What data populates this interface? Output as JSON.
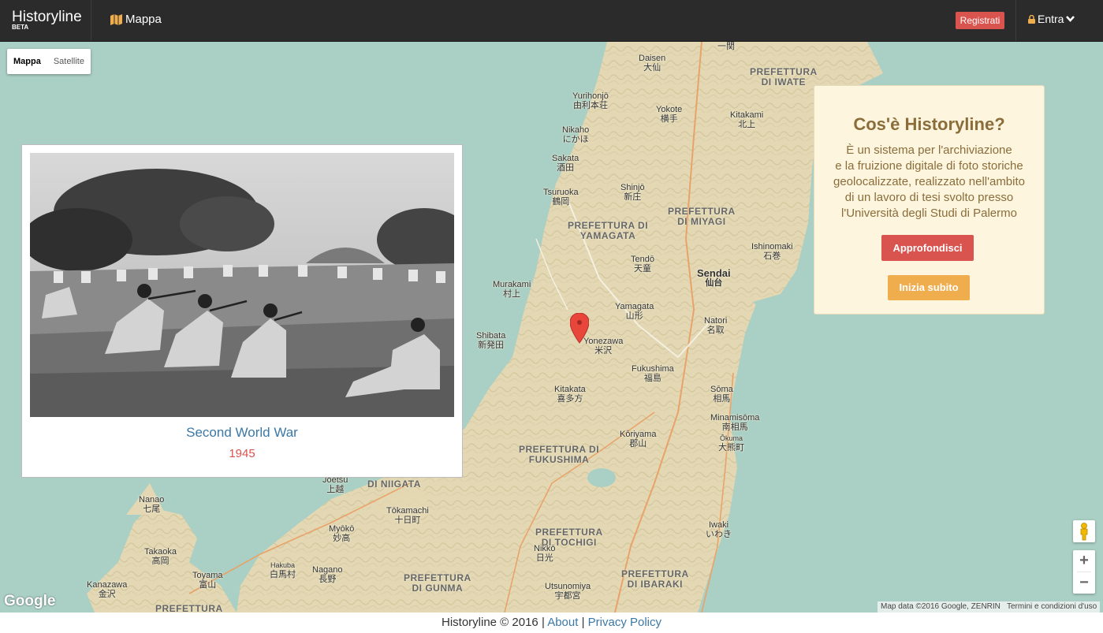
{
  "navbar": {
    "brand": "Historyline",
    "beta": "BETA",
    "map_link": "Mappa",
    "register": "Registrati",
    "login": "Entra",
    "icons": [
      "map-icon",
      "lock-icon",
      "chevron-down-icon"
    ]
  },
  "map_type": {
    "map": "Mappa",
    "satellite": "Satellite",
    "selected": "Mappa"
  },
  "photo_card": {
    "title": "Second World War",
    "year": "1945"
  },
  "info_panel": {
    "title": "Cos'è Historyline?",
    "text_lines": [
      "È un sistema per l'archiviazione",
      "e la fruizione digitale di foto storiche",
      "geolocalizzate, realizzato nell'ambito",
      "di un lavoro di tesi svolto presso",
      "l'Università degli Studi di Palermo"
    ],
    "btn_more": "Approfondisci",
    "btn_start": "Inizia subito"
  },
  "map_labels": {
    "daisen": "Daisen",
    "daisen_jp": "大仙",
    "yurihonjo": "Yurihonjō",
    "yurihonjo_jp": "由利本荘",
    "yokote": "Yokote",
    "yokote_jp": "横手",
    "kitakami": "Kitakami",
    "kitakami_jp": "北上",
    "nikaho": "Nikaho",
    "nikaho_jp": "にかほ",
    "sakata": "Sakata",
    "sakata_jp": "酒田",
    "tsuruoka": "Tsuruoka",
    "tsuruoka_jp": "鶴岡",
    "shinjo": "Shinjō",
    "shinjo_jp": "新庄",
    "ishinomaki": "Ishinomaki",
    "ishinomaki_jp": "石巻",
    "tendo": "Tendō",
    "tendo_jp": "天童",
    "sendai": "Sendai",
    "sendai_jp": "仙台",
    "murakami": "Murakami",
    "murakami_jp": "村上",
    "yamagata": "Yamagata",
    "yamagata_jp": "山形",
    "natori": "Natori",
    "natori_jp": "名取",
    "shibata": "Shibata",
    "shibata_jp": "新発田",
    "yonezawa": "Yonezawa",
    "yonezawa_jp": "米沢",
    "fukushima": "Fukushima",
    "fukushima_jp": "福島",
    "kitakata": "Kitakata",
    "kitakata_jp": "喜多方",
    "soma": "Sōma",
    "soma_jp": "相馬",
    "minamisoma": "Minamisōma",
    "minamisoma_jp": "南相馬",
    "okuma": "Ōkuma",
    "okuma_jp": "大熊町",
    "koriyama": "Kōriyama",
    "koriyama_jp": "郡山",
    "joetsu": "Joetsu",
    "joetsu_jp": "上越",
    "nanao": "Nanao",
    "nanao_jp": "七尾",
    "tokamachi": "Tōkamachi",
    "tokamachi_jp": "十日町",
    "myoko": "Myōkō",
    "myoko_jp": "妙高",
    "iwaki": "Iwaki",
    "iwaki_jp": "いわき",
    "takaoka": "Takaoka",
    "takaoka_jp": "高岡",
    "hakuba": "Hakuba",
    "hakuba_jp": "白馬村",
    "nagano": "Nagano",
    "nagano_jp": "長野",
    "nikko": "Nikkō",
    "nikko_jp": "日光",
    "toyama": "Toyama",
    "toyama_jp": "富山",
    "utsunomiya": "Utsunomiya",
    "utsunomiya_jp": "宇都宮",
    "kanazawa": "Kanazawa",
    "kanazawa_jp": "金沢",
    "ichinoseki_jp": "一関"
  },
  "prefectures": {
    "iwate": "PREFETTURA\nDI IWATE",
    "miyagi": "PREFETTURA\nDI MIYAGI",
    "yamagata": "PREFETTURA DI\nYAMAGATA",
    "fukushima": "PREFETTURA DI\nFUKUSHIMA",
    "niigata": "DI NIIGATA",
    "tochigi": "PREFETTURA\nDI TOCHIGI",
    "ibaraki": "PREFETTURA\nDI IBARAKI",
    "gunma": "PREFETTURA\nDI GUNMA",
    "bottom": "PREFETTURA"
  },
  "google_logo": "Google",
  "attribution": {
    "data": "Map data ©2016 Google, ZENRIN",
    "terms": "Termini e condizioni d'uso"
  },
  "footer": {
    "copyright": "Historyline © 2016",
    "about": "About",
    "privacy": "Privacy Policy"
  },
  "colors": {
    "navbar": "#2b2b2b",
    "register": "#d9534f",
    "more": "#d9534f",
    "start": "#f0ad4e",
    "panel_bg": "#fdf5dd",
    "panel_text": "#8a6d3b",
    "link": "#3b78a6",
    "year": "#d9534f",
    "sea": "#aacfc4",
    "land": "#e6dcb8"
  }
}
